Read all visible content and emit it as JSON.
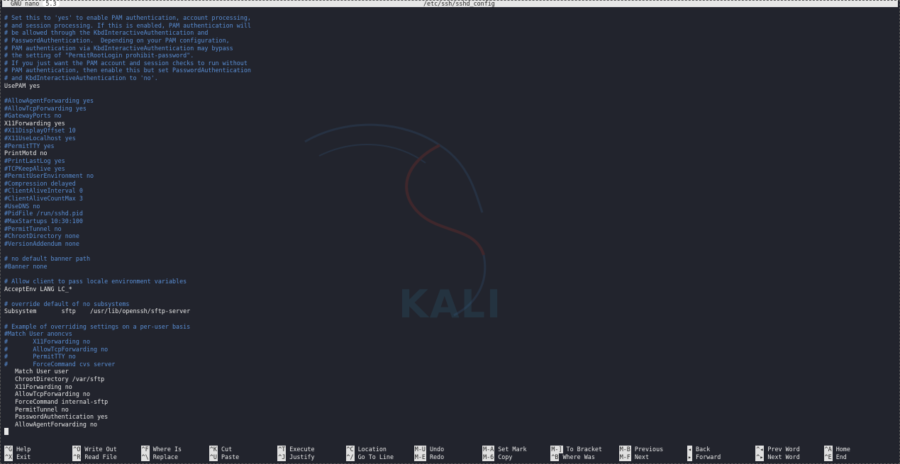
{
  "titlebar": {
    "app": "GNU nano",
    "version": "5.3",
    "filename": "/etc/ssh/sshd_config"
  },
  "watermark": {
    "text": "KALI",
    "icon": "kali-dragon-logo-icon"
  },
  "lines": [
    {
      "text": "# Set this to 'yes' to enable PAM authentication, account processing,",
      "type": "comment"
    },
    {
      "text": "# and session processing. If this is enabled, PAM authentication will",
      "type": "comment"
    },
    {
      "text": "# be allowed through the KbdInteractiveAuthentication and",
      "type": "comment"
    },
    {
      "text": "# PasswordAuthentication.  Depending on your PAM configuration,",
      "type": "comment"
    },
    {
      "text": "# PAM authentication via KbdInteractiveAuthentication may bypass",
      "type": "comment"
    },
    {
      "text": "# the setting of \"PermitRootLogin prohibit-password\".",
      "type": "comment"
    },
    {
      "text": "# If you just want the PAM account and session checks to run without",
      "type": "comment"
    },
    {
      "text": "# PAM authentication, then enable this but set PasswordAuthentication",
      "type": "comment"
    },
    {
      "text": "# and KbdInteractiveAuthentication to 'no'.",
      "type": "comment"
    },
    {
      "text": "UsePAM yes",
      "type": "directive"
    },
    {
      "text": "",
      "type": "blank"
    },
    {
      "text": "#AllowAgentForwarding yes",
      "type": "comment"
    },
    {
      "text": "#AllowTcpForwarding yes",
      "type": "comment"
    },
    {
      "text": "#GatewayPorts no",
      "type": "comment"
    },
    {
      "text": "X11Forwarding yes",
      "type": "directive"
    },
    {
      "text": "#X11DisplayOffset 10",
      "type": "comment"
    },
    {
      "text": "#X11UseLocalhost yes",
      "type": "comment"
    },
    {
      "text": "#PermitTTY yes",
      "type": "comment"
    },
    {
      "text": "PrintMotd no",
      "type": "directive"
    },
    {
      "text": "#PrintLastLog yes",
      "type": "comment"
    },
    {
      "text": "#TCPKeepAlive yes",
      "type": "comment"
    },
    {
      "text": "#PermitUserEnvironment no",
      "type": "comment"
    },
    {
      "text": "#Compression delayed",
      "type": "comment"
    },
    {
      "text": "#ClientAliveInterval 0",
      "type": "comment"
    },
    {
      "text": "#ClientAliveCountMax 3",
      "type": "comment"
    },
    {
      "text": "#UseDNS no",
      "type": "comment"
    },
    {
      "text": "#PidFile /run/sshd.pid",
      "type": "comment"
    },
    {
      "text": "#MaxStartups 10:30:100",
      "type": "comment"
    },
    {
      "text": "#PermitTunnel no",
      "type": "comment"
    },
    {
      "text": "#ChrootDirectory none",
      "type": "comment"
    },
    {
      "text": "#VersionAddendum none",
      "type": "comment"
    },
    {
      "text": "",
      "type": "blank"
    },
    {
      "text": "# no default banner path",
      "type": "comment"
    },
    {
      "text": "#Banner none",
      "type": "comment"
    },
    {
      "text": "",
      "type": "blank"
    },
    {
      "text": "# Allow client to pass locale environment variables",
      "type": "comment"
    },
    {
      "text": "AcceptEnv LANG LC_*",
      "type": "directive"
    },
    {
      "text": "",
      "type": "blank"
    },
    {
      "text": "# override default of no subsystems",
      "type": "comment"
    },
    {
      "text": "Subsystem       sftp    /usr/lib/openssh/sftp-server",
      "type": "directive"
    },
    {
      "text": "",
      "type": "blank"
    },
    {
      "text": "# Example of overriding settings on a per-user basis",
      "type": "comment"
    },
    {
      "text": "#Match User anoncvs",
      "type": "comment"
    },
    {
      "text": "#       X11Forwarding no",
      "type": "comment"
    },
    {
      "text": "#       AllowTcpForwarding no",
      "type": "comment"
    },
    {
      "text": "#       PermitTTY no",
      "type": "comment"
    },
    {
      "text": "#       ForceCommand cvs server",
      "type": "comment"
    },
    {
      "text": "   Match User user",
      "type": "directive"
    },
    {
      "text": "   ChrootDirectory /var/sftp",
      "type": "directive"
    },
    {
      "text": "   X11Forwarding no",
      "type": "directive"
    },
    {
      "text": "   AllowTcpForwarding no",
      "type": "directive"
    },
    {
      "text": "   ForceCommand internal-sftp",
      "type": "directive"
    },
    {
      "text": "   PermitTunnel no",
      "type": "directive"
    },
    {
      "text": "   PasswordAuthentication yes",
      "type": "directive"
    },
    {
      "text": "   AllowAgentForwarding no",
      "type": "directive"
    }
  ],
  "shortcuts": [
    {
      "key": "^G",
      "label": "Help"
    },
    {
      "key": "^X",
      "label": "Exit"
    },
    {
      "key": "^O",
      "label": "Write Out"
    },
    {
      "key": "^R",
      "label": "Read File"
    },
    {
      "key": "^F",
      "label": "Where Is"
    },
    {
      "key": "^\\",
      "label": "Replace"
    },
    {
      "key": "^K",
      "label": "Cut"
    },
    {
      "key": "^U",
      "label": "Paste"
    },
    {
      "key": "^T",
      "label": "Execute"
    },
    {
      "key": "^J",
      "label": "Justify"
    },
    {
      "key": "^C",
      "label": "Location"
    },
    {
      "key": "^/",
      "label": "Go To Line"
    },
    {
      "key": "M-U",
      "label": "Undo"
    },
    {
      "key": "M-E",
      "label": "Redo"
    },
    {
      "key": "M-A",
      "label": "Set Mark"
    },
    {
      "key": "M-6",
      "label": "Copy"
    },
    {
      "key": "M-]",
      "label": "To Bracket"
    },
    {
      "key": "^B",
      "label": "Where Was"
    },
    {
      "key": "M-B",
      "label": "Previous"
    },
    {
      "key": "M-F",
      "label": "Next"
    },
    {
      "key": "◂",
      "label": "Back"
    },
    {
      "key": "▸",
      "label": "Forward"
    },
    {
      "key": "^◂",
      "label": "Prev Word"
    },
    {
      "key": "^▸",
      "label": "Next Word"
    },
    {
      "key": "^A",
      "label": "Home"
    },
    {
      "key": "^E",
      "label": "End"
    }
  ],
  "colors": {
    "background": "#22242d",
    "comment": "#5a8fd6",
    "directive": "#e8e8e8"
  }
}
